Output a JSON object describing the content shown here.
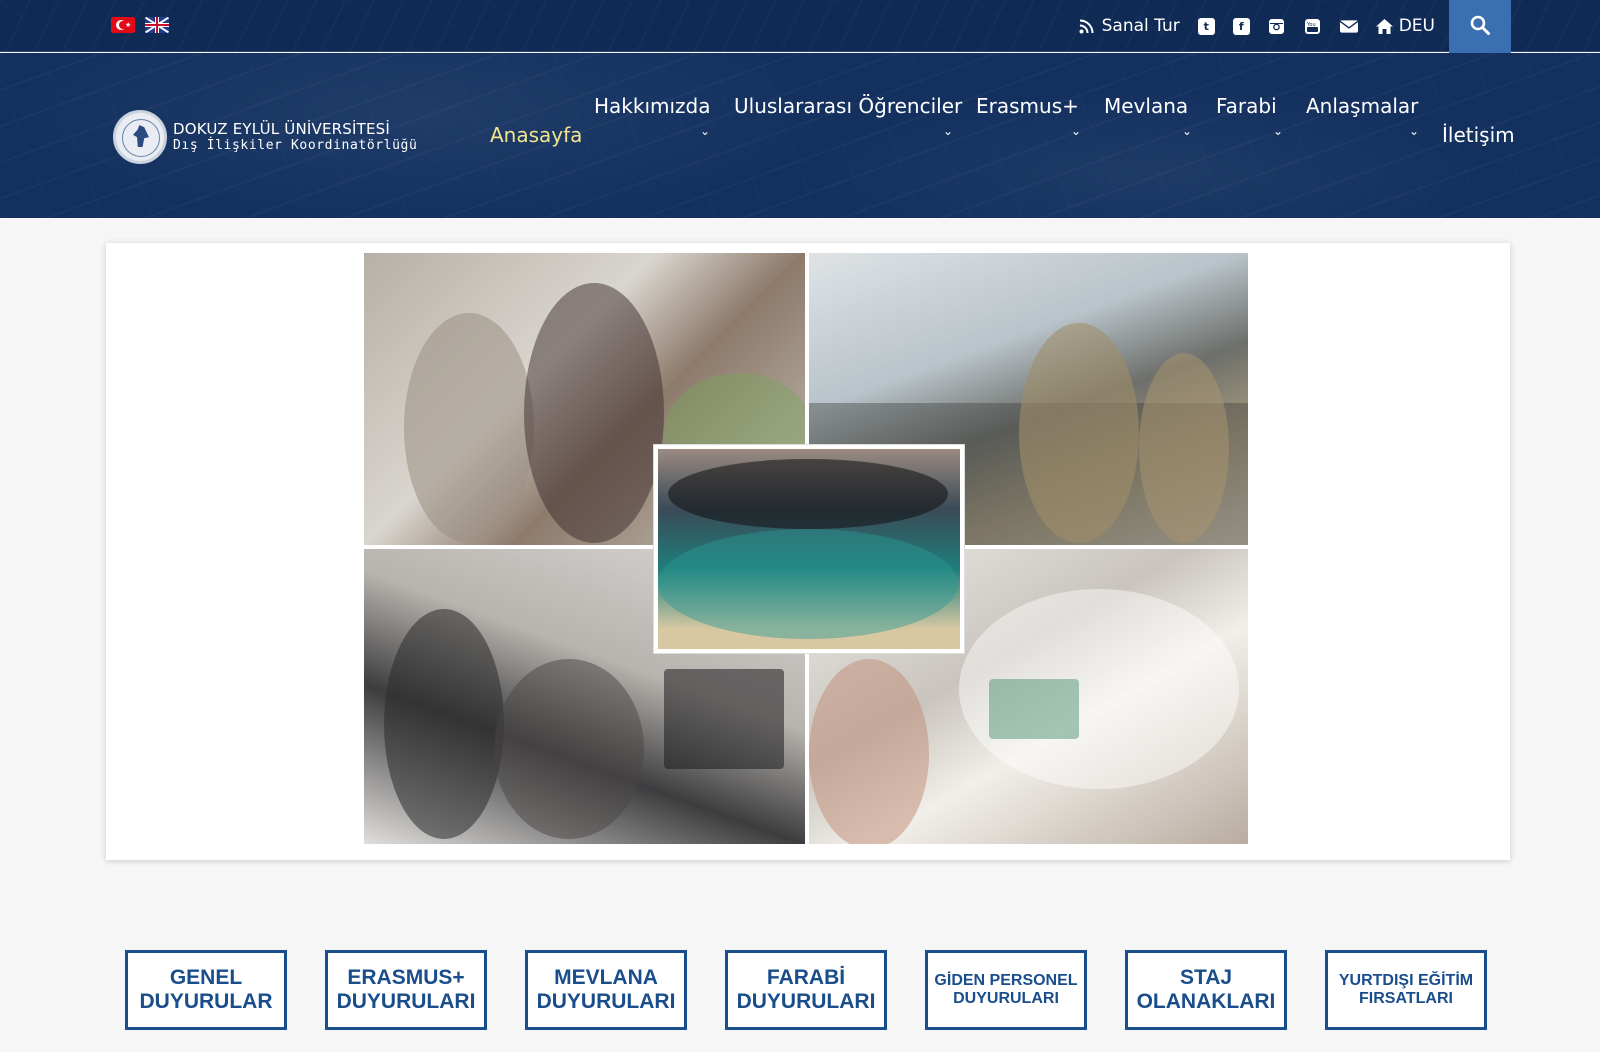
{
  "topbar": {
    "links": {
      "sanal_tur": "Sanal Tur",
      "deu": "DEU"
    },
    "social": [
      "twitter-icon",
      "facebook-icon",
      "instagram-icon",
      "youtube-icon",
      "envelope-icon"
    ]
  },
  "logo": {
    "line1": "DOKUZ EYLÜL ÜNİVERSİTESİ",
    "line2": "Dış İlişkiler Koordinatörlüğü"
  },
  "nav": {
    "home": "Anasayfa",
    "about": "Hakkımızda",
    "intl_students": "Uluslararası Öğrenciler",
    "erasmus": "Erasmus+",
    "mevlana": "Mevlana",
    "farabi": "Farabi",
    "agreements": "Anlaşmalar",
    "contact": "İletişim"
  },
  "buttons": {
    "genel": [
      "GENEL",
      "DUYURULAR"
    ],
    "erasmus": [
      "ERASMUS+",
      "DUYURULARI"
    ],
    "mevlana": [
      "MEVLANA",
      "DUYURULARI"
    ],
    "farabi": [
      "FARABİ",
      "DUYURULARI"
    ],
    "personel": [
      "GİDEN PERSONEL",
      "DUYURULARI"
    ],
    "staj": [
      "STAJ",
      "OLANAKLARI"
    ],
    "yurtdisi": [
      "YURTDIŞI EĞİTİM",
      "FIRSATLARI"
    ]
  },
  "colors": {
    "topbar_bg": "#0f2a55",
    "header_bg": "#13305f",
    "accent_blue": "#1a4d8c",
    "search_bg": "#3a6fb1",
    "active_nav": "#f2e58f"
  }
}
